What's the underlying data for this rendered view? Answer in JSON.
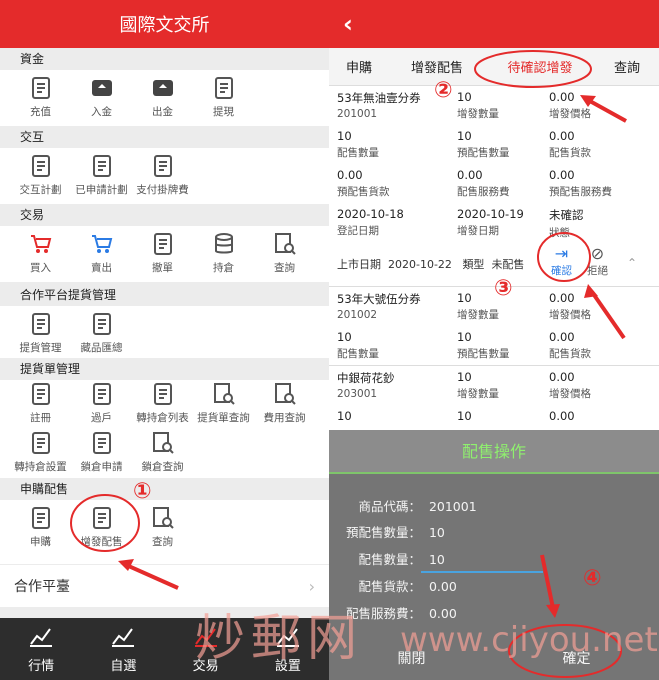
{
  "left": {
    "title": "國際文交所",
    "sections": [
      {
        "title": "資金",
        "items": [
          {
            "label": "充值",
            "icon": "wallet-icon"
          },
          {
            "label": "入金",
            "icon": "deposit-icon"
          },
          {
            "label": "出金",
            "icon": "withdraw-icon"
          },
          {
            "label": "提現",
            "icon": "cashout-icon"
          }
        ]
      },
      {
        "title": "交互",
        "items": [
          {
            "label": "交互計劃",
            "icon": "transfer-plan-icon"
          },
          {
            "label": "已申請計劃",
            "icon": "applied-plan-icon"
          },
          {
            "label": "支付掛牌費",
            "icon": "pay-listing-icon"
          }
        ]
      },
      {
        "title": "交易",
        "items": [
          {
            "label": "買入",
            "icon": "buy-cart-icon"
          },
          {
            "label": "賣出",
            "icon": "sell-cart-icon"
          },
          {
            "label": "撤單",
            "icon": "cancel-order-icon"
          },
          {
            "label": "持倉",
            "icon": "holdings-icon"
          },
          {
            "label": "查詢",
            "icon": "query-icon"
          }
        ]
      },
      {
        "title": "合作平台提貨管理",
        "items": [
          {
            "label": "提貨管理",
            "icon": "pickup-manage-icon"
          },
          {
            "label": "藏品匯總",
            "icon": "collection-summary-icon"
          }
        ]
      },
      {
        "title": "提貨單管理",
        "items": [
          {
            "label": "註冊",
            "icon": "register-icon"
          },
          {
            "label": "過戶",
            "icon": "transfer-icon"
          },
          {
            "label": "轉持倉列表",
            "icon": "convert-list-icon"
          },
          {
            "label": "提貨單查詢",
            "icon": "bill-query-icon"
          },
          {
            "label": "費用查詢",
            "icon": "fee-query-icon"
          },
          {
            "label": "轉持倉設置",
            "icon": "convert-settings-icon"
          },
          {
            "label": "鎖倉申請",
            "icon": "lock-apply-icon"
          },
          {
            "label": "鎖倉查詢",
            "icon": "lock-query-icon"
          }
        ]
      },
      {
        "title": "申購配售",
        "items": [
          {
            "label": "申購",
            "icon": "subscribe-icon"
          },
          {
            "label": "增發配售",
            "icon": "additional-issue-icon"
          },
          {
            "label": "查詢",
            "icon": "query-icon"
          }
        ]
      }
    ],
    "nav_row": "合作平臺",
    "tabbar": [
      {
        "label": "行情",
        "icon": "chart-icon"
      },
      {
        "label": "自選",
        "icon": "cart-add-icon"
      },
      {
        "label": "交易",
        "icon": "trade-icon"
      },
      {
        "label": "設置",
        "icon": "settings-icon"
      }
    ]
  },
  "right": {
    "back": "‹",
    "tabs": [
      "申購",
      "增發配售",
      "待確認增發",
      "查詢"
    ],
    "active_tab": "待確認增發",
    "cards": [
      {
        "rows": [
          [
            {
              "v": "53年無油壹分券",
              "l": "201001"
            },
            {
              "v": "10",
              "l": "增發數量"
            },
            {
              "v": "0.00",
              "l": "增發價格"
            }
          ],
          [
            {
              "v": "10",
              "l": "配售數量"
            },
            {
              "v": "10",
              "l": "預配售數量"
            },
            {
              "v": "0.00",
              "l": "配售貨款"
            }
          ],
          [
            {
              "v": "0.00",
              "l": "預配售貨款"
            },
            {
              "v": "0.00",
              "l": "配售服務費"
            },
            {
              "v": "0.00",
              "l": "預配售服務費"
            }
          ],
          [
            {
              "v": "2020-10-18",
              "l": "登記日期"
            },
            {
              "v": "2020-10-19",
              "l": "增發日期"
            },
            {
              "v": "未確認",
              "l": "狀態"
            }
          ]
        ],
        "footer": {
          "listing_label": "上市日期",
          "listing_date": "2020-10-22",
          "type_label": "類型",
          "type_value": "未配售",
          "confirm": "確認",
          "reject": "拒絕"
        }
      },
      {
        "rows": [
          [
            {
              "v": "53年大號伍分券",
              "l": "201002"
            },
            {
              "v": "10",
              "l": "增發數量"
            },
            {
              "v": "0.00",
              "l": "增發價格"
            }
          ],
          [
            {
              "v": "10",
              "l": "配售數量"
            },
            {
              "v": "10",
              "l": "預配售數量"
            },
            {
              "v": "0.00",
              "l": "配售貨款"
            }
          ]
        ]
      },
      {
        "rows": [
          [
            {
              "v": "中銀荷花鈔",
              "l": "203001"
            },
            {
              "v": "10",
              "l": "增發數量"
            },
            {
              "v": "0.00",
              "l": "增發價格"
            }
          ],
          [
            {
              "v": "10",
              "l": ""
            },
            {
              "v": "10",
              "l": ""
            },
            {
              "v": "0.00",
              "l": ""
            }
          ]
        ]
      }
    ],
    "modal": {
      "title": "配售操作",
      "fields": [
        {
          "k": "商品代碼：",
          "v": "201001"
        },
        {
          "k": "預配售數量：",
          "v": "10"
        },
        {
          "k": "配售數量：",
          "v": "10"
        },
        {
          "k": "配售貨款：",
          "v": "0.00"
        },
        {
          "k": "配售服務費：",
          "v": "0.00"
        }
      ],
      "cancel": "關閉",
      "ok": "確定"
    }
  },
  "annotations": [
    "①",
    "②",
    "③",
    "④"
  ],
  "watermark": {
    "cn": "炒郵网",
    "url": "www.cjiyou.net"
  },
  "colors": {
    "brand_red": "#e42b2b",
    "modal_title": "#8ff06e",
    "tabbar": "#2d2d2d"
  }
}
